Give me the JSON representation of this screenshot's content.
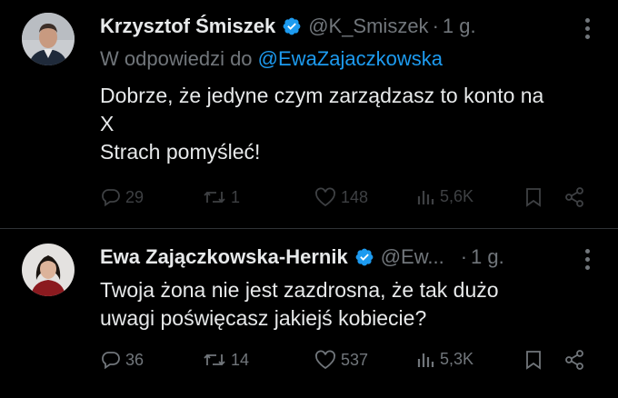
{
  "tweets": [
    {
      "author_name": "Krzysztof Śmiszek",
      "handle": "@K_Smiszek",
      "separator": "·",
      "time": "1 g.",
      "reply_prefix": "W odpowiedzi do",
      "reply_mention": "@EwaZajaczkowska",
      "text_lines": [
        "Dobrze, że jedyne czym zarządzasz to konto na",
        "X",
        "Strach pomyśleć!"
      ],
      "replies": "29",
      "reposts": "1",
      "likes": "148",
      "views": "5,6K"
    },
    {
      "author_name": "Ewa Zajączkowska-Hernik",
      "handle": "@Ew...",
      "separator": "·",
      "time": "1 g.",
      "text_lines": [
        "Twoja żona nie jest zazdrosna, że tak dużo",
        "uwagi poświęcasz jakiejś kobiecie?"
      ],
      "replies": "36",
      "reposts": "14",
      "likes": "537",
      "views": "5,3K"
    }
  ],
  "icons": {
    "reply": "reply-icon",
    "repost": "repost-icon",
    "like": "heart-icon",
    "views": "views-icon",
    "bookmark": "bookmark-icon",
    "share": "share-icon",
    "verified": "verified-badge-icon",
    "more": "more-icon"
  },
  "colors": {
    "background": "#000000",
    "text": "#e7e9ea",
    "secondary": "#71767b",
    "link": "#1d9bf0",
    "verified_badge": "#1d9bf0"
  }
}
